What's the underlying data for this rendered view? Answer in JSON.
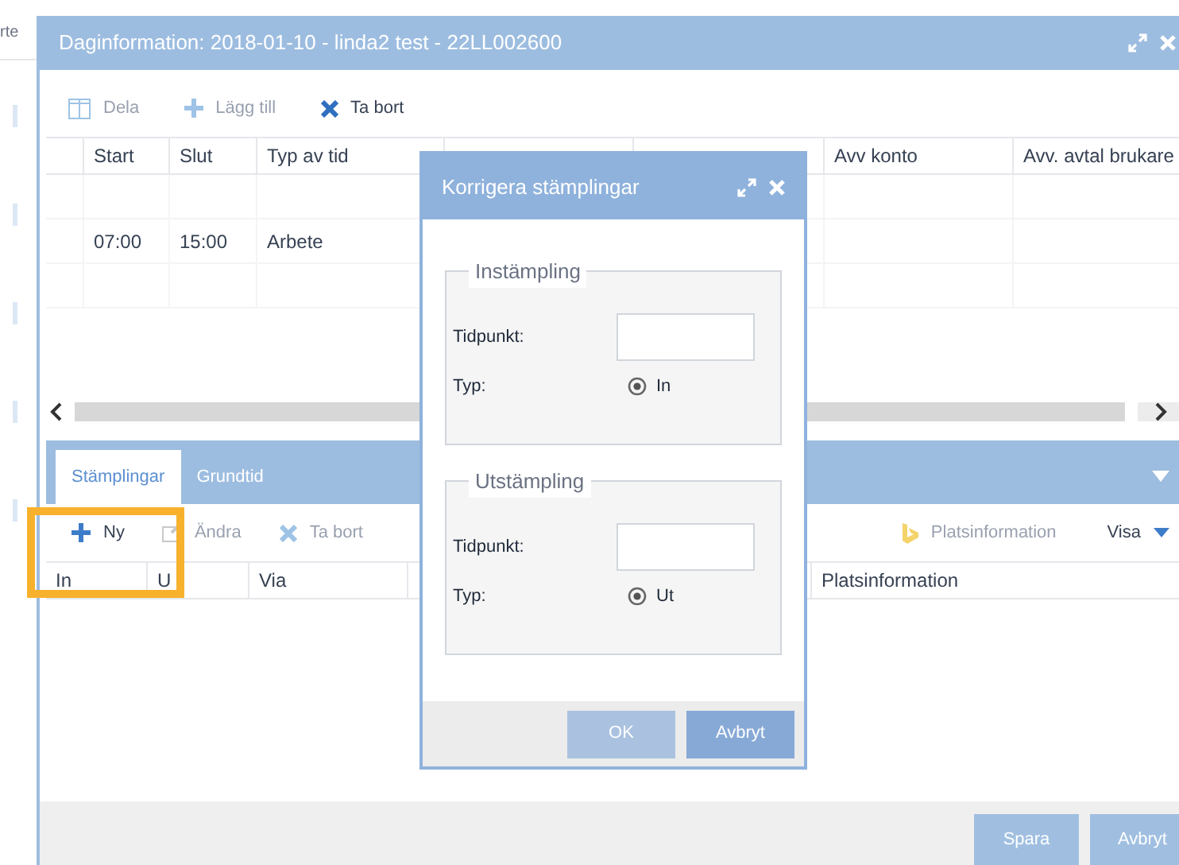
{
  "side_strip": {
    "label": "rte"
  },
  "window": {
    "title": "Daginformation: 2018-01-10 - linda2 test - 22LL002600",
    "toolbar": [
      {
        "label": "Dela",
        "kind": "columns",
        "disabled": true
      },
      {
        "label": "Lägg till",
        "kind": "plus",
        "disabled": true
      },
      {
        "label": "Ta bort",
        "kind": "cross",
        "disabled": false
      }
    ],
    "table": {
      "columns": [
        {},
        {
          "label": "Start"
        },
        {
          "label": "Slut"
        },
        {
          "label": "Typ av tid"
        },
        {},
        {},
        {
          "label": "Avv konto"
        },
        {
          "label": "Avv. avtal brukare"
        }
      ],
      "rows": [
        {
          "blank": true
        },
        {
          "blank": false,
          "cells": [
            "07:00",
            "15:00",
            "Arbete"
          ]
        },
        {
          "blank": true
        }
      ]
    },
    "tabs": [
      {
        "label": "Stämplingar",
        "selected": true
      },
      {
        "label": "Grundtid",
        "selected": false
      }
    ],
    "toolbar2": [
      {
        "label": "Ny",
        "kind": "plus",
        "disabled": false
      },
      {
        "label": "Ändra",
        "kind": "edit",
        "disabled": true
      },
      {
        "label": "Ta bort",
        "kind": "cross",
        "disabled": true
      }
    ],
    "toolbar2_right": [
      {
        "label": "Platsinformation",
        "kind": "bing",
        "disabled": true
      },
      {
        "label": "Visa",
        "kind": "caret",
        "disabled": false
      }
    ],
    "table2": {
      "columns": [
        {
          "label": "In"
        },
        {
          "label": "U"
        },
        {
          "label": "Via"
        },
        {},
        {
          "label": "Platsinformation"
        }
      ]
    },
    "buttons": [
      {
        "label": "Spara",
        "disabled": false
      },
      {
        "label": "Avbryt",
        "disabled": false
      }
    ]
  },
  "dialog": {
    "title": "Korrigera stämplingar",
    "groups": [
      {
        "legend": "Instämpling",
        "time_label": "Tidpunkt:",
        "type_label": "Typ:",
        "radio": {
          "label": "In",
          "selected": true
        }
      },
      {
        "legend": "Utstämpling",
        "time_label": "Tidpunkt:",
        "type_label": "Typ:",
        "radio": {
          "label": "Ut",
          "selected": true
        }
      }
    ],
    "buttons": [
      {
        "label": "OK",
        "disabled": true
      },
      {
        "label": "Avbryt",
        "disabled": false
      }
    ]
  }
}
